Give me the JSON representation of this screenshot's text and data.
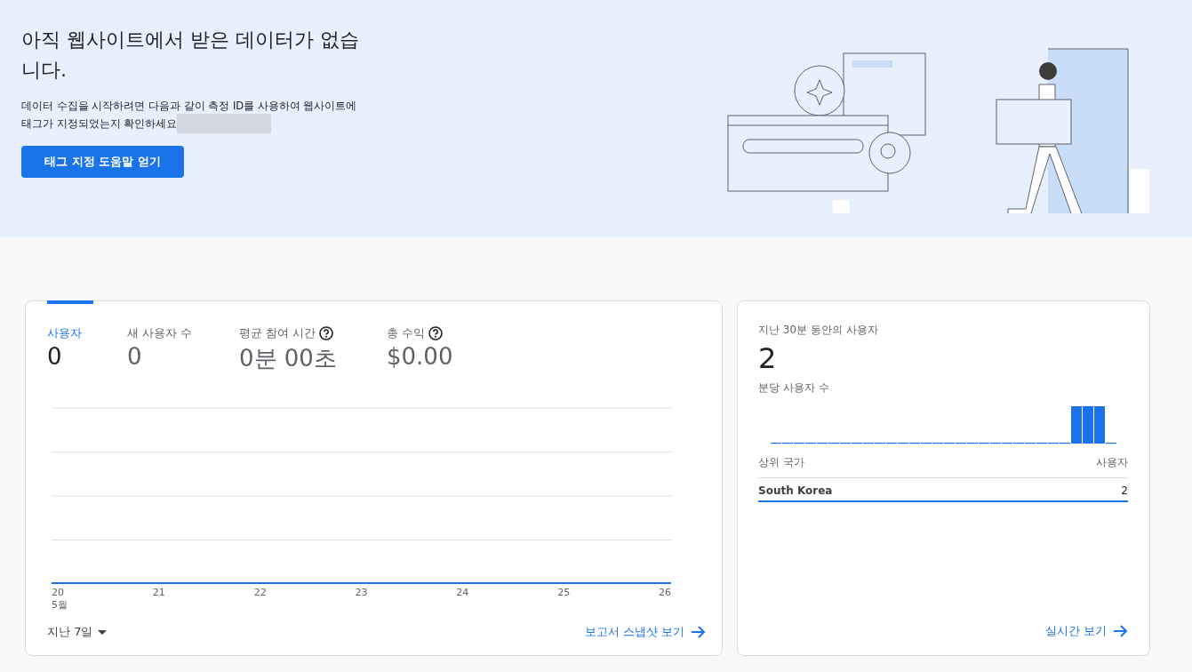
{
  "banner": {
    "title": "아직 웹사이트에서 받은 데이터가 없습니다.",
    "description": "데이터 수집을 시작하려면 다음과 같이 측정 ID를 사용하여 웹사이트에 태그가 지정되었는지 확인하세요",
    "button": "태그 지정 도움말 얻기"
  },
  "overview_card": {
    "metrics": [
      {
        "label": "사용자",
        "value": "0",
        "selected": true,
        "help": false
      },
      {
        "label": "새 사용자 수",
        "value": "0",
        "selected": false,
        "help": false
      },
      {
        "label": "평균 참여 시간",
        "value": "0분 00초",
        "selected": false,
        "help": true
      },
      {
        "label": "총 수익",
        "value": "$0.00",
        "selected": false,
        "help": true
      }
    ],
    "x_labels": [
      "20",
      "21",
      "22",
      "23",
      "24",
      "25",
      "26"
    ],
    "month_label": "5월",
    "date_range": "지난 7일",
    "link": "보고서 스냅샷 보기"
  },
  "realtime_card": {
    "title": "지난 30분 동안의 사용자",
    "value": "2",
    "subtitle": "분당 사용자 수",
    "table_header": [
      "상위 국가",
      "사용자"
    ],
    "rows": [
      {
        "country": "South Korea",
        "users": "2",
        "level": 1
      }
    ],
    "link": "실시간 보기"
  }
}
